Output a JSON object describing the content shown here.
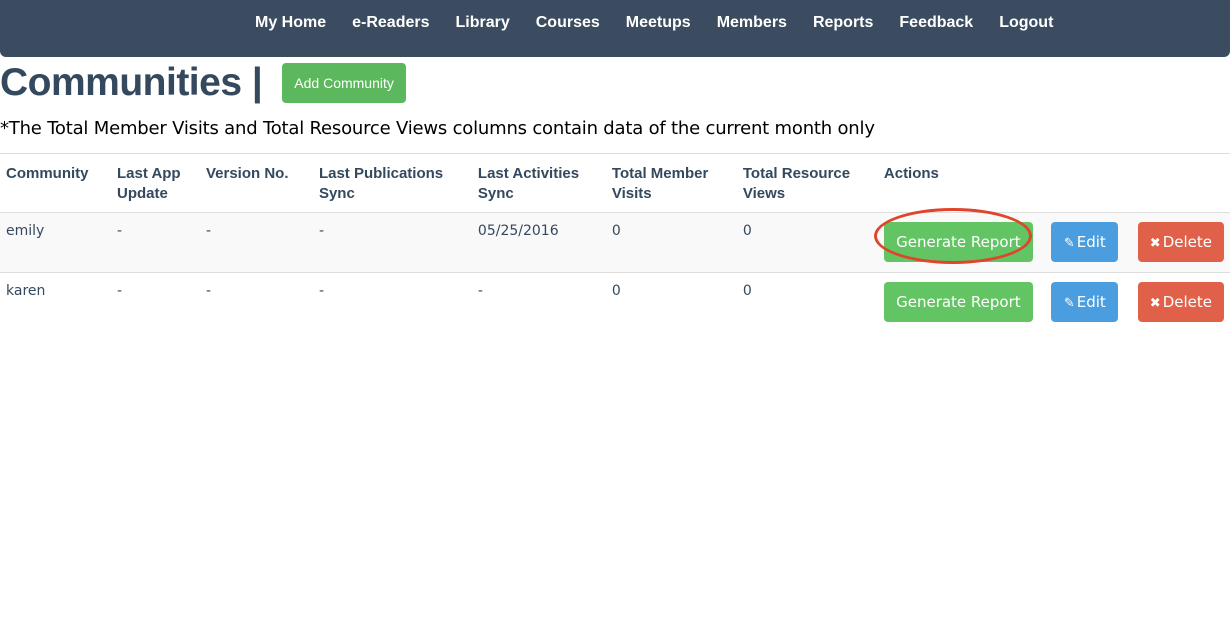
{
  "nav": {
    "items": [
      "My Home",
      "e-Readers",
      "Library",
      "Courses",
      "Meetups",
      "Members",
      "Reports",
      "Feedback",
      "Logout"
    ]
  },
  "page": {
    "title": "Communities |",
    "add_button": "Add Community",
    "note": "*The Total Member Visits and Total Resource Views columns contain data of the current month only"
  },
  "table": {
    "headers": [
      "Community",
      "Last App Update",
      "Version No.",
      "Last Publications Sync",
      "Last Activities Sync",
      "Total Member Visits",
      "Total Resource Views",
      "Actions"
    ],
    "rows": [
      {
        "community": "emily",
        "last_app_update": "-",
        "version": "-",
        "last_pub_sync": "-",
        "last_act_sync": "05/25/2016",
        "member_visits": "0",
        "resource_views": "0"
      },
      {
        "community": "karen",
        "last_app_update": "-",
        "version": "-",
        "last_pub_sync": "-",
        "last_act_sync": "-",
        "member_visits": "0",
        "resource_views": "0"
      }
    ],
    "actions": {
      "generate": "Generate Report",
      "edit": "Edit",
      "delete": "Delete"
    }
  },
  "icons": {
    "edit": "pencil-icon",
    "delete": "x-icon"
  },
  "colors": {
    "navbar": "#3b4c60",
    "success": "#62c462",
    "info": "#4a9ee0",
    "danger": "#e0604a",
    "annotation": "#e0442c"
  }
}
